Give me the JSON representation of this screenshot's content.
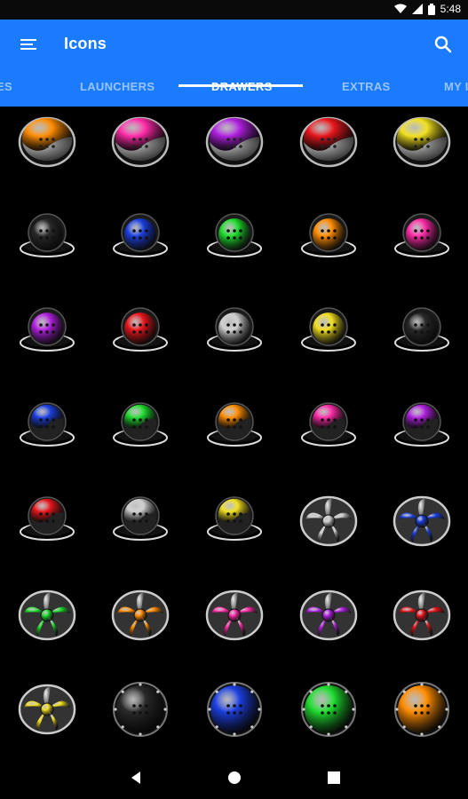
{
  "status_bar": {
    "time": "5:48",
    "icons": [
      "wifi-icon",
      "signal-icon",
      "battery-icon"
    ]
  },
  "app_bar": {
    "title": "Icons",
    "menu_icon": "menu-icon",
    "search_icon": "search-icon",
    "color": "#1a7bff"
  },
  "tabs": [
    {
      "label": "ES",
      "active": false
    },
    {
      "label": "LAUNCHERS",
      "active": false
    },
    {
      "label": "DRAWERS",
      "active": true
    },
    {
      "label": "EXTRAS",
      "active": false
    },
    {
      "label": "MY I",
      "active": false
    }
  ],
  "icon_grid": {
    "rows": [
      [
        {
          "style": "half",
          "color": "#ff8c00"
        },
        {
          "style": "half",
          "color": "#ff2aa8"
        },
        {
          "style": "half",
          "color": "#b020e0"
        },
        {
          "style": "half",
          "color": "#e8161c"
        },
        {
          "style": "half",
          "color": "#f2e020"
        }
      ],
      [
        {
          "style": "ball",
          "color": "#2a2a2a"
        },
        {
          "style": "ball",
          "color": "#1c3fe0"
        },
        {
          "style": "ball",
          "color": "#1fdd2f"
        },
        {
          "style": "ball",
          "color": "#ff8c00"
        },
        {
          "style": "ball",
          "color": "#ff2aa8"
        }
      ],
      [
        {
          "style": "ball",
          "color": "#b020e0"
        },
        {
          "style": "ball",
          "color": "#e8161c"
        },
        {
          "style": "ball",
          "color": "#cfcfcf"
        },
        {
          "style": "ball",
          "color": "#f2e020"
        },
        {
          "style": "ball",
          "color": "#2a2a2a"
        }
      ],
      [
        {
          "style": "ballhalf",
          "color": "#1c3fe0"
        },
        {
          "style": "ballhalf",
          "color": "#1fdd2f"
        },
        {
          "style": "ballhalf",
          "color": "#ff8c00"
        },
        {
          "style": "ballhalf",
          "color": "#ff2aa8"
        },
        {
          "style": "ballhalf",
          "color": "#b020e0"
        }
      ],
      [
        {
          "style": "ballhalf",
          "color": "#e8161c"
        },
        {
          "style": "ballhalf",
          "color": "#cfcfcf"
        },
        {
          "style": "ballhalf",
          "color": "#f2e020"
        },
        {
          "style": "fan",
          "color": "#cfcfcf"
        },
        {
          "style": "fan",
          "color": "#1c3fe0"
        }
      ],
      [
        {
          "style": "fan",
          "color": "#1fdd2f"
        },
        {
          "style": "fan",
          "color": "#ff8c00"
        },
        {
          "style": "fan",
          "color": "#ff2aa8"
        },
        {
          "style": "fan",
          "color": "#b020e0"
        },
        {
          "style": "fan",
          "color": "#e8161c"
        }
      ],
      [
        {
          "style": "fan",
          "color": "#f2e020"
        },
        {
          "style": "cog",
          "color": "#2a2a2a"
        },
        {
          "style": "cog",
          "color": "#1c3fe0"
        },
        {
          "style": "cog",
          "color": "#1fdd2f"
        },
        {
          "style": "cog",
          "color": "#ff8c00"
        }
      ]
    ]
  },
  "nav_bar": {
    "buttons": [
      "back-icon",
      "home-icon",
      "recents-icon"
    ]
  }
}
